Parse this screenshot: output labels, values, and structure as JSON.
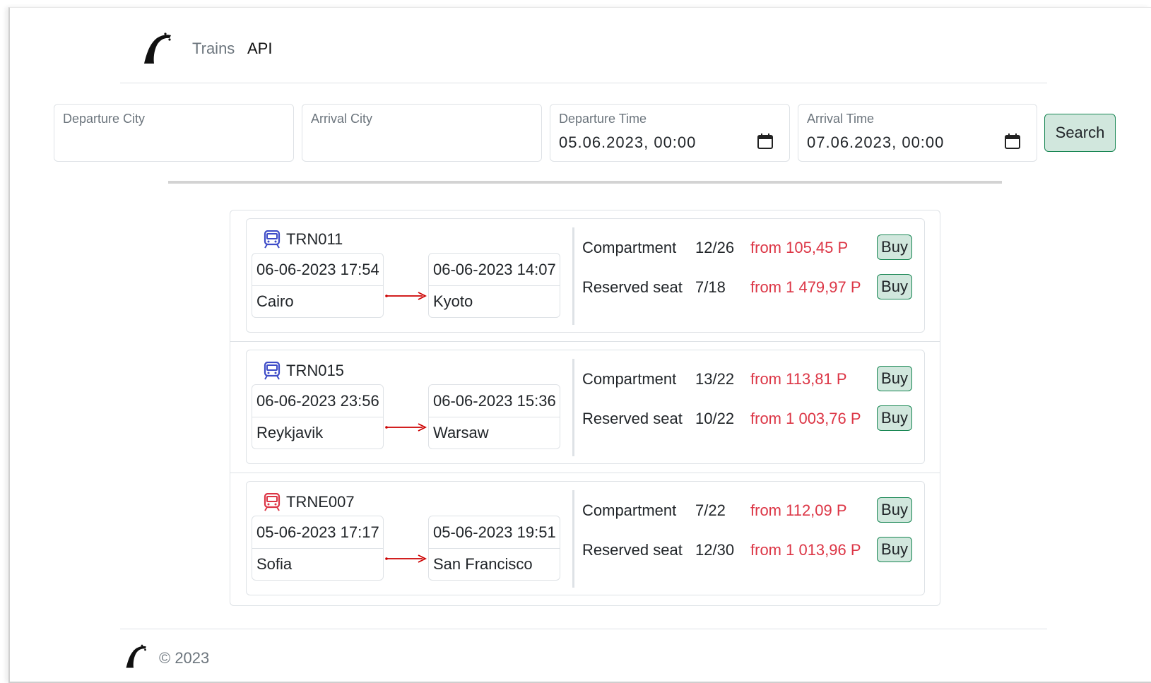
{
  "nav": {
    "links": [
      {
        "label": "Trains"
      },
      {
        "label": "API"
      }
    ]
  },
  "search": {
    "departure_city": {
      "label": "Departure City",
      "value": ""
    },
    "arrival_city": {
      "label": "Arrival City",
      "value": ""
    },
    "departure_time": {
      "label": "Departure Time",
      "value": "05.06.2023, 00:00"
    },
    "arrival_time": {
      "label": "Arrival Time",
      "value": "07.06.2023, 00:00"
    },
    "button_label": "Search"
  },
  "trains": [
    {
      "number": "TRN011",
      "icon_color": "#3d4bc7",
      "departure": {
        "time": "06-06-2023 17:54",
        "city": "Cairo"
      },
      "arrival": {
        "time": "06-06-2023 14:07",
        "city": "Kyoto"
      },
      "seats": [
        {
          "type": "Compartment",
          "available": "12/26",
          "price": "from 105,45 P",
          "buy_label": "Buy"
        },
        {
          "type": "Reserved seat",
          "available": "7/18",
          "price": "from 1 479,97 P",
          "buy_label": "Buy"
        }
      ]
    },
    {
      "number": "TRN015",
      "icon_color": "#3d4bc7",
      "departure": {
        "time": "06-06-2023 23:56",
        "city": "Reykjavik"
      },
      "arrival": {
        "time": "06-06-2023 15:36",
        "city": "Warsaw"
      },
      "seats": [
        {
          "type": "Compartment",
          "available": "13/22",
          "price": "from 113,81 P",
          "buy_label": "Buy"
        },
        {
          "type": "Reserved seat",
          "available": "10/22",
          "price": "from 1 003,76 P",
          "buy_label": "Buy"
        }
      ]
    },
    {
      "number": "TRNE007",
      "icon_color": "#dc3545",
      "departure": {
        "time": "05-06-2023 17:17",
        "city": "Sofia"
      },
      "arrival": {
        "time": "05-06-2023 19:51",
        "city": "San Francisco"
      },
      "seats": [
        {
          "type": "Compartment",
          "available": "7/22",
          "price": "from 112,09 P",
          "buy_label": "Buy"
        },
        {
          "type": "Reserved seat",
          "available": "12/30",
          "price": "from 1 013,96 P",
          "buy_label": "Buy"
        }
      ]
    }
  ],
  "footer": {
    "copyright": "© 2023"
  },
  "colors": {
    "price": "#dc3545",
    "button_bg": "#d1e7dd",
    "button_border": "#198754",
    "arrow": "#cc0000"
  }
}
